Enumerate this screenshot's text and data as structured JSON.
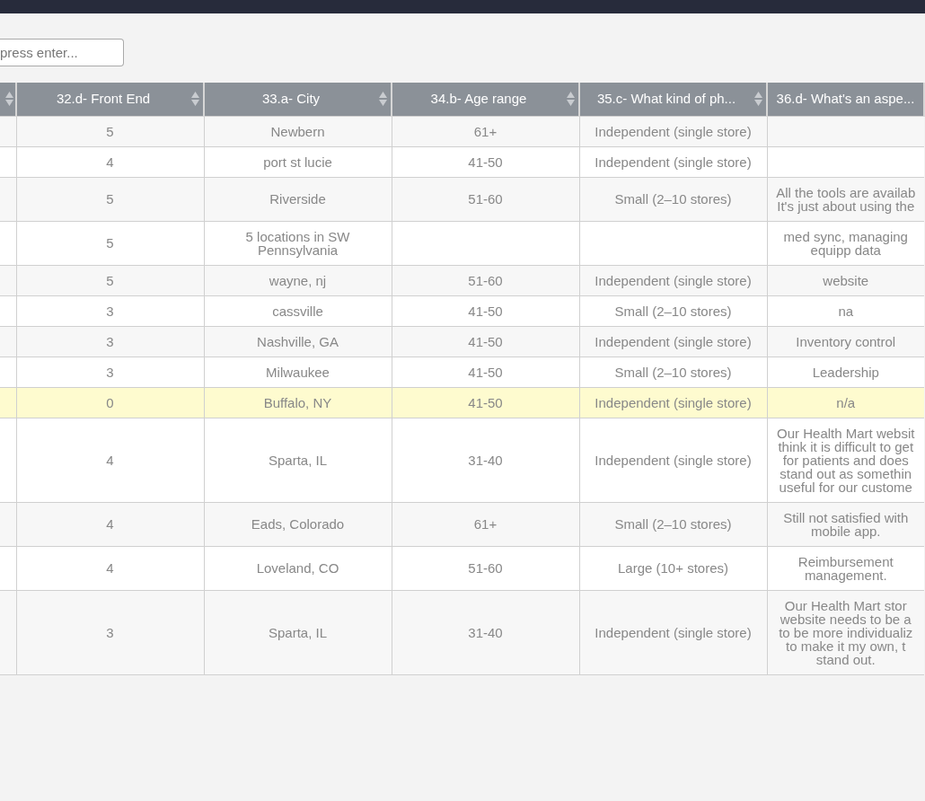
{
  "search": {
    "placeholder": "press enter..."
  },
  "table": {
    "columns": [
      {
        "sortable": true
      },
      {
        "label": "32.d- Front End",
        "sortable": true
      },
      {
        "label": "33.a- City",
        "sortable": true
      },
      {
        "label": "34.b- Age range",
        "sortable": true
      },
      {
        "label": "35.c- What kind of ph...",
        "sortable": true
      },
      {
        "label": "36.d- What's an aspe...",
        "sortable": false
      }
    ],
    "rows": [
      {
        "selected": false,
        "cells": [
          "",
          "5",
          "Newbern",
          "61+",
          "Independent (single store)",
          ""
        ]
      },
      {
        "selected": false,
        "cells": [
          "",
          "4",
          "port st lucie",
          "41-50",
          "Independent (single store)",
          ""
        ]
      },
      {
        "selected": false,
        "cells": [
          "",
          "5",
          "Riverside",
          "51-60",
          "Small (2–10 stores)",
          "All the tools are availab\nIt's just about using the"
        ]
      },
      {
        "selected": false,
        "cells": [
          "",
          "5",
          "5 locations in SW\nPennsylvania",
          "",
          "",
          "med sync, managing\nequipp data"
        ]
      },
      {
        "selected": false,
        "cells": [
          "",
          "5",
          "wayne, nj",
          "51-60",
          "Independent (single store)",
          "website"
        ]
      },
      {
        "selected": false,
        "cells": [
          "",
          "3",
          "cassville",
          "41-50",
          "Small (2–10 stores)",
          "na"
        ]
      },
      {
        "selected": false,
        "cells": [
          "",
          "3",
          "Nashville, GA",
          "41-50",
          "Independent (single store)",
          "Inventory control"
        ]
      },
      {
        "selected": false,
        "cells": [
          "",
          "3",
          "Milwaukee",
          "41-50",
          "Small (2–10 stores)",
          "Leadership"
        ]
      },
      {
        "selected": true,
        "cells": [
          "",
          "0",
          "Buffalo, NY",
          "41-50",
          "Independent (single store)",
          "n/a"
        ]
      },
      {
        "selected": false,
        "cells": [
          "",
          "4",
          "Sparta, IL",
          "31-40",
          "Independent (single store)",
          "Our Health Mart websit\nthink it is difficult to get\nfor patients and does\nstand out as somethin\nuseful for our custome"
        ]
      },
      {
        "selected": false,
        "cells": [
          "",
          "4",
          "Eads, Colorado",
          "61+",
          "Small (2–10 stores)",
          "Still not satisfied with\nmobile app."
        ]
      },
      {
        "selected": false,
        "cells": [
          "",
          "4",
          "Loveland, CO",
          "51-60",
          "Large (10+ stores)",
          "Reimbursement\nmanagement."
        ]
      },
      {
        "selected": false,
        "cells": [
          "",
          "3",
          "Sparta, IL",
          "31-40",
          "Independent (single store)",
          "Our Health Mart stor\nwebsite needs to be a\nto be more individualiz\nto make it my own, t\nstand out."
        ]
      }
    ]
  }
}
